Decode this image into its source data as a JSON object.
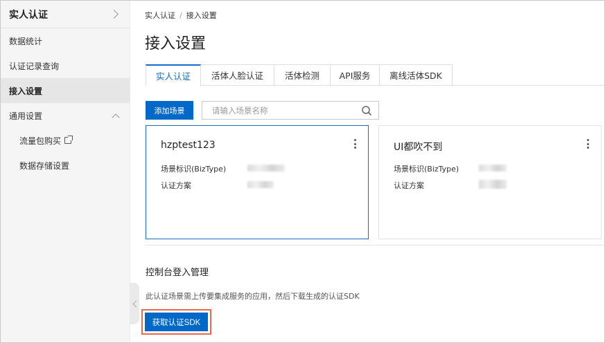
{
  "sidebar": {
    "title": "实人认证",
    "items": [
      {
        "label": "数据统计"
      },
      {
        "label": "认证记录查询"
      },
      {
        "label": "接入设置"
      },
      {
        "label": "通用设置"
      },
      {
        "label": "流量包购买"
      },
      {
        "label": "数据存储设置"
      }
    ]
  },
  "breadcrumb": {
    "root": "实人认证",
    "separator": "/",
    "current": "接入设置"
  },
  "page_title": "接入设置",
  "tabs": [
    {
      "label": "实人认证",
      "active": true
    },
    {
      "label": "活体人脸认证"
    },
    {
      "label": "活体检测"
    },
    {
      "label": "API服务"
    },
    {
      "label": "离线活体SDK"
    }
  ],
  "toolbar": {
    "add_label": "添加场景",
    "search_placeholder": "请输入场景名称"
  },
  "cards": [
    {
      "title": "hzptest123",
      "biztype_label": "场景标识(BizType)",
      "scheme_label": "认证方案"
    },
    {
      "title": "UI都吹不到",
      "biztype_label": "场景标识(BizType)",
      "scheme_label": "认证方案"
    }
  ],
  "console": {
    "title": "控制台登入管理",
    "description": "此认证场景需上传要集成服务的应用，然后下载生成的认证SDK",
    "button_label": "获取认证SDK"
  },
  "colors": {
    "accent": "#0068c8",
    "highlight": "#e86a4b"
  }
}
